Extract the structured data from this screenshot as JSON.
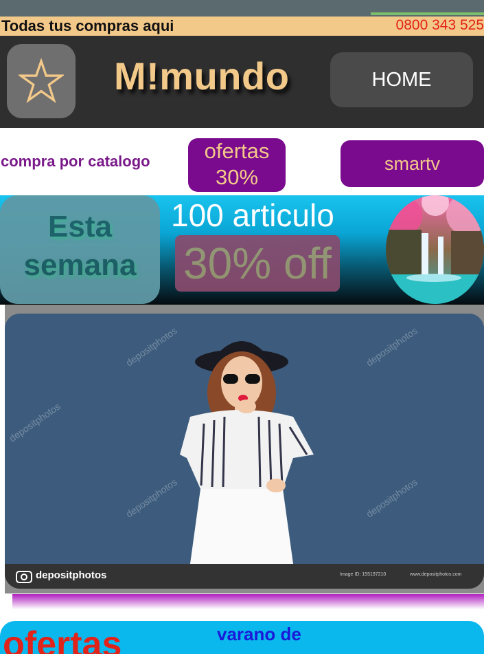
{
  "top_bar": {
    "left_text": "Todas tus compras aqui",
    "phone": "0800 343 525"
  },
  "header": {
    "brand": "M!mundo",
    "home_label": "HOME",
    "star_icon": "star-icon"
  },
  "nav": {
    "catalog_text": "compra por catalogo",
    "ofertas_label_line1": "ofertas",
    "ofertas_label_line2": "30%",
    "smarttv_label": "smartv"
  },
  "banner": {
    "esta_line1": "Esta",
    "esta_line2": "semana",
    "articulo": "100 articulo",
    "off": "30% off"
  },
  "photo": {
    "watermark_brand": "depositphotos",
    "image_id": "Image ID: 155197210",
    "site": "www.depositphotos.com"
  },
  "bottom": {
    "big": "ofertas",
    "small": "varano de"
  },
  "colors": {
    "accent_gold": "#f3c98a",
    "purple": "#7a0a8e",
    "phone_red": "#e2231a",
    "header_dark": "#2f2f2f"
  }
}
